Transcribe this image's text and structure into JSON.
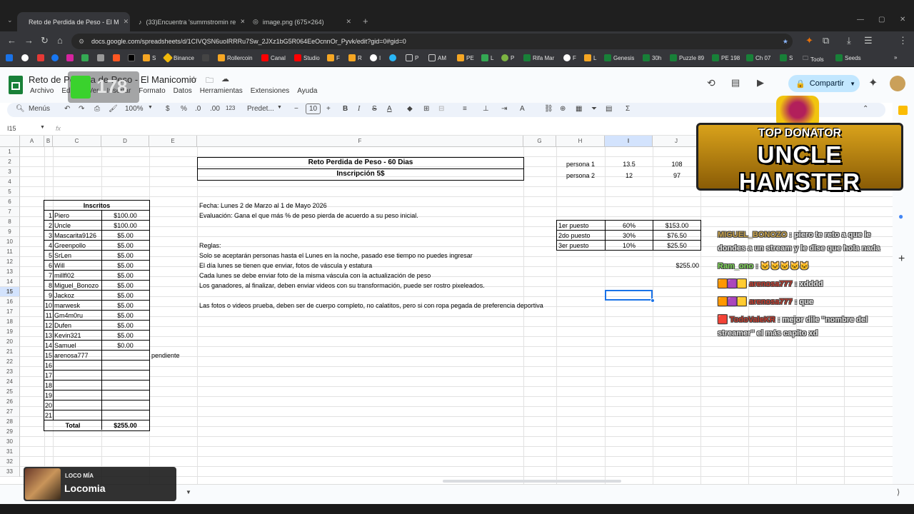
{
  "browser": {
    "tabs": [
      {
        "label": "Reto de Perdida de Peso - El M"
      },
      {
        "label": "(33)Encuentra 'summstromin re"
      },
      {
        "label": "image.png (675×264)"
      }
    ],
    "url": "docs.google.com/spreadsheets/d/1CIVQSN6uoIRRRu7Sw_2JXz1bG5R064EeOcnnOr_Pyvk/edit?gid=0#gid=0",
    "bookmarks": [
      "S",
      "Binance",
      "Rollercoin",
      "Canal",
      "Studio",
      "F",
      "R",
      "I",
      "P",
      "AM",
      "PE",
      "L",
      "P",
      "Rifa Mar",
      "F",
      "L",
      "Genesis",
      "30h",
      "Puzzle 89",
      "PE 198",
      "Ch 07",
      "S",
      "Tools",
      "Seeds"
    ]
  },
  "sheets": {
    "doc_title": "Reto de Perdida de Peso - El Manicomio",
    "menu": [
      "Archivo",
      "Editar",
      "Ver",
      "Insertar",
      "Formato",
      "Datos",
      "Herramientas",
      "Extensiones",
      "Ayuda"
    ],
    "share_label": "Compartir",
    "toolbar": {
      "menus": "Menús",
      "zoom": "100%",
      "currency": "$",
      "percent": "%",
      "dec_less": ".0",
      "dec_more": ".00",
      "num_fmt": "123",
      "font": "Predet...",
      "font_size": "10"
    },
    "name_box": "I15",
    "fx": "fx",
    "columns": [
      "A",
      "B",
      "C",
      "D",
      "E",
      "F",
      "G",
      "H",
      "I",
      "J"
    ],
    "rows": [
      "1",
      "2",
      "3",
      "4",
      "5",
      "6",
      "7",
      "8",
      "9",
      "10",
      "11",
      "12",
      "13",
      "14",
      "15",
      "16",
      "17",
      "18",
      "19",
      "20",
      "21",
      "22",
      "23",
      "24",
      "25",
      "26",
      "27",
      "28",
      "29",
      "30",
      "31",
      "32",
      "33"
    ],
    "title_box": {
      "line1": "Reto Perdida de Peso - 60 Dias",
      "line2": "Inscripción 5$"
    },
    "participants_header": "Inscritos",
    "participants": [
      {
        "n": "1",
        "name": "Piero",
        "amount": "$100.00"
      },
      {
        "n": "2",
        "name": "Uncle",
        "amount": "$100.00"
      },
      {
        "n": "3",
        "name": "Mascarita9126",
        "amount": "$5.00"
      },
      {
        "n": "4",
        "name": "Greenpollo",
        "amount": "$5.00"
      },
      {
        "n": "5",
        "name": "SrLen",
        "amount": "$5.00"
      },
      {
        "n": "6",
        "name": "Will",
        "amount": "$5.00"
      },
      {
        "n": "7",
        "name": "millfl02",
        "amount": "$5.00"
      },
      {
        "n": "8",
        "name": "Miguel_Bonozo",
        "amount": "$5.00"
      },
      {
        "n": "9",
        "name": "Jackoz",
        "amount": "$5.00"
      },
      {
        "n": "10",
        "name": "marwesk",
        "amount": "$5.00"
      },
      {
        "n": "11",
        "name": "Gm4m0ru",
        "amount": "$5.00"
      },
      {
        "n": "12",
        "name": "Dufen",
        "amount": "$5.00"
      },
      {
        "n": "13",
        "name": "Kevin321",
        "amount": "$5.00"
      },
      {
        "n": "14",
        "name": "Samuel",
        "amount": "$0.00"
      },
      {
        "n": "15",
        "name": "arenosa777",
        "amount": ""
      },
      {
        "n": "16",
        "name": "",
        "amount": ""
      },
      {
        "n": "17",
        "name": "",
        "amount": ""
      },
      {
        "n": "18",
        "name": "",
        "amount": ""
      },
      {
        "n": "19",
        "name": "",
        "amount": ""
      },
      {
        "n": "20",
        "name": "",
        "amount": ""
      },
      {
        "n": "21",
        "name": "",
        "amount": ""
      }
    ],
    "pending_note": "pendiente",
    "total_label": "Total",
    "total_amount": "$255.00",
    "info": {
      "fecha": "Fecha: Lunes 2 de Marzo al 1 de Mayo 2026",
      "evaluacion": "Evaluación: Gana el que más % de peso pierda de acuerdo a su peso inicial.",
      "reglas": "Reglas:",
      "r1": "Solo se aceptarán personas hasta el Lunes en la noche, pasado ese tiempo no puedes ingresar",
      "r2": "El día lunes se tienen que enviar, fotos de váscula y estatura",
      "r3": "Cada lunes se debe enviar foto de la misma váscula con la actualización de peso",
      "r4": "Los ganadores, al finalizar, deben enviar videos con su transformación, puede ser rostro pixeleados.",
      "r5": "Las fotos o videos prueba, deben ser de cuerpo completo, no calatitos, pero si con ropa pegada de preferencia deportiva"
    },
    "persons": [
      {
        "label": "persona 1",
        "i": "13.5",
        "j": "108"
      },
      {
        "label": "persona 2",
        "i": "12",
        "j": "97"
      }
    ],
    "prizes": [
      {
        "place": "1er puesto",
        "pct": "60%",
        "amount": "$153.00"
      },
      {
        "place": "2do puesto",
        "pct": "30%",
        "amount": "$76.50"
      },
      {
        "place": "3er puesto",
        "pct": "10%",
        "amount": "$25.50"
      }
    ],
    "prize_total": "$255.00"
  },
  "overlay": {
    "banner_top": "TOP DONATOR",
    "banner_name": "UNCLE HAMSTER",
    "counter": "178",
    "chat": [
      {
        "user": "MIGUEL_BONOZO",
        "text": ": piero te reto a que le dondes a un stream y le dise que hola nada"
      },
      {
        "user": "Ram_ono",
        "text": ":"
      },
      {
        "user": "arenosa777",
        "text": ": xdddd"
      },
      {
        "user": "arenosa777",
        "text": ": que"
      },
      {
        "user": "TodoValeKR",
        "text": ": mejor dile \"nombre del streamer\" el más capito xd"
      }
    ],
    "music_label": "LOCO MÍA",
    "music_title": "Locomia"
  },
  "colors": {
    "accent": "#0b57d0",
    "sheets_green": "#188038",
    "chat_user": "#c0392b",
    "miguel": "#c8a24a"
  }
}
